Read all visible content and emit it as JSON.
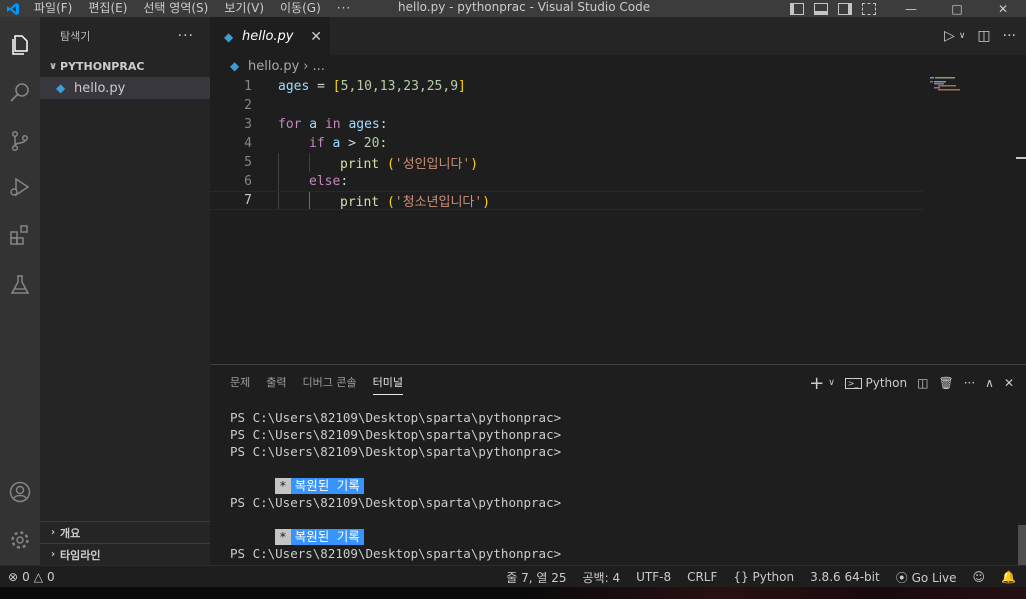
{
  "titlebar": {
    "menus": [
      "파일(F)",
      "편집(E)",
      "선택 영역(S)",
      "보기(V)",
      "이동(G)",
      "···"
    ],
    "window_title": "hello.py - pythonprac - Visual Studio Code"
  },
  "sidebar": {
    "title": "탐색기",
    "folder": "PYTHONPRAC",
    "file": "hello.py",
    "sections": [
      "개요",
      "타임라인"
    ]
  },
  "editor": {
    "tab_label": "hello.py",
    "breadcrumb_file": "hello.py",
    "breadcrumb_more": "...",
    "line_numbers": [
      "1",
      "2",
      "3",
      "4",
      "5",
      "6",
      "7"
    ],
    "code": {
      "l1_var": "ages",
      "l1_op": " = ",
      "l1_open": "[",
      "l1_nums": "5,10,13,23,25,9",
      "l1_close": "]",
      "l3_for": "for",
      "l3_a": " a ",
      "l3_in": "in",
      "l3_ages": " ages",
      "l3_colon": ":",
      "l4_if": "if",
      "l4_a": " a ",
      "l4_gt": "> ",
      "l4_num": "20",
      "l4_colon": ":",
      "l5_print": "print",
      "l5_open": " (",
      "l5_str": "'성인입니다'",
      "l5_close": ")",
      "l6_else": "else",
      "l6_colon": ":",
      "l7_print": "print",
      "l7_open": " (",
      "l7_str": "'청소년입니다'",
      "l7_close": ")"
    }
  },
  "panel": {
    "tabs": [
      "문제",
      "출력",
      "디버그 콘솔",
      "터미널"
    ],
    "active_tab": "터미널",
    "terminal_profile": "Python",
    "prompt": "PS C:\\Users\\82109\\Desktop\\sparta\\pythonprac>",
    "restored_star": "*",
    "restored_label": "복원된 기록"
  },
  "statusbar": {
    "errors": "0",
    "warnings": "0",
    "position": "줄 7, 열 25",
    "spaces": "공백: 4",
    "encoding": "UTF-8",
    "eol": "CRLF",
    "language": "Python",
    "interpreter": "3.8.6 64-bit",
    "golive": "Go Live"
  },
  "colors": {
    "accent": "#0098ff",
    "keyword": "#c586c0",
    "variable": "#9cdcfe",
    "number": "#b5cea8",
    "function": "#dcdcaa",
    "string": "#ce9178",
    "restored_highlight": "#3794ff"
  }
}
